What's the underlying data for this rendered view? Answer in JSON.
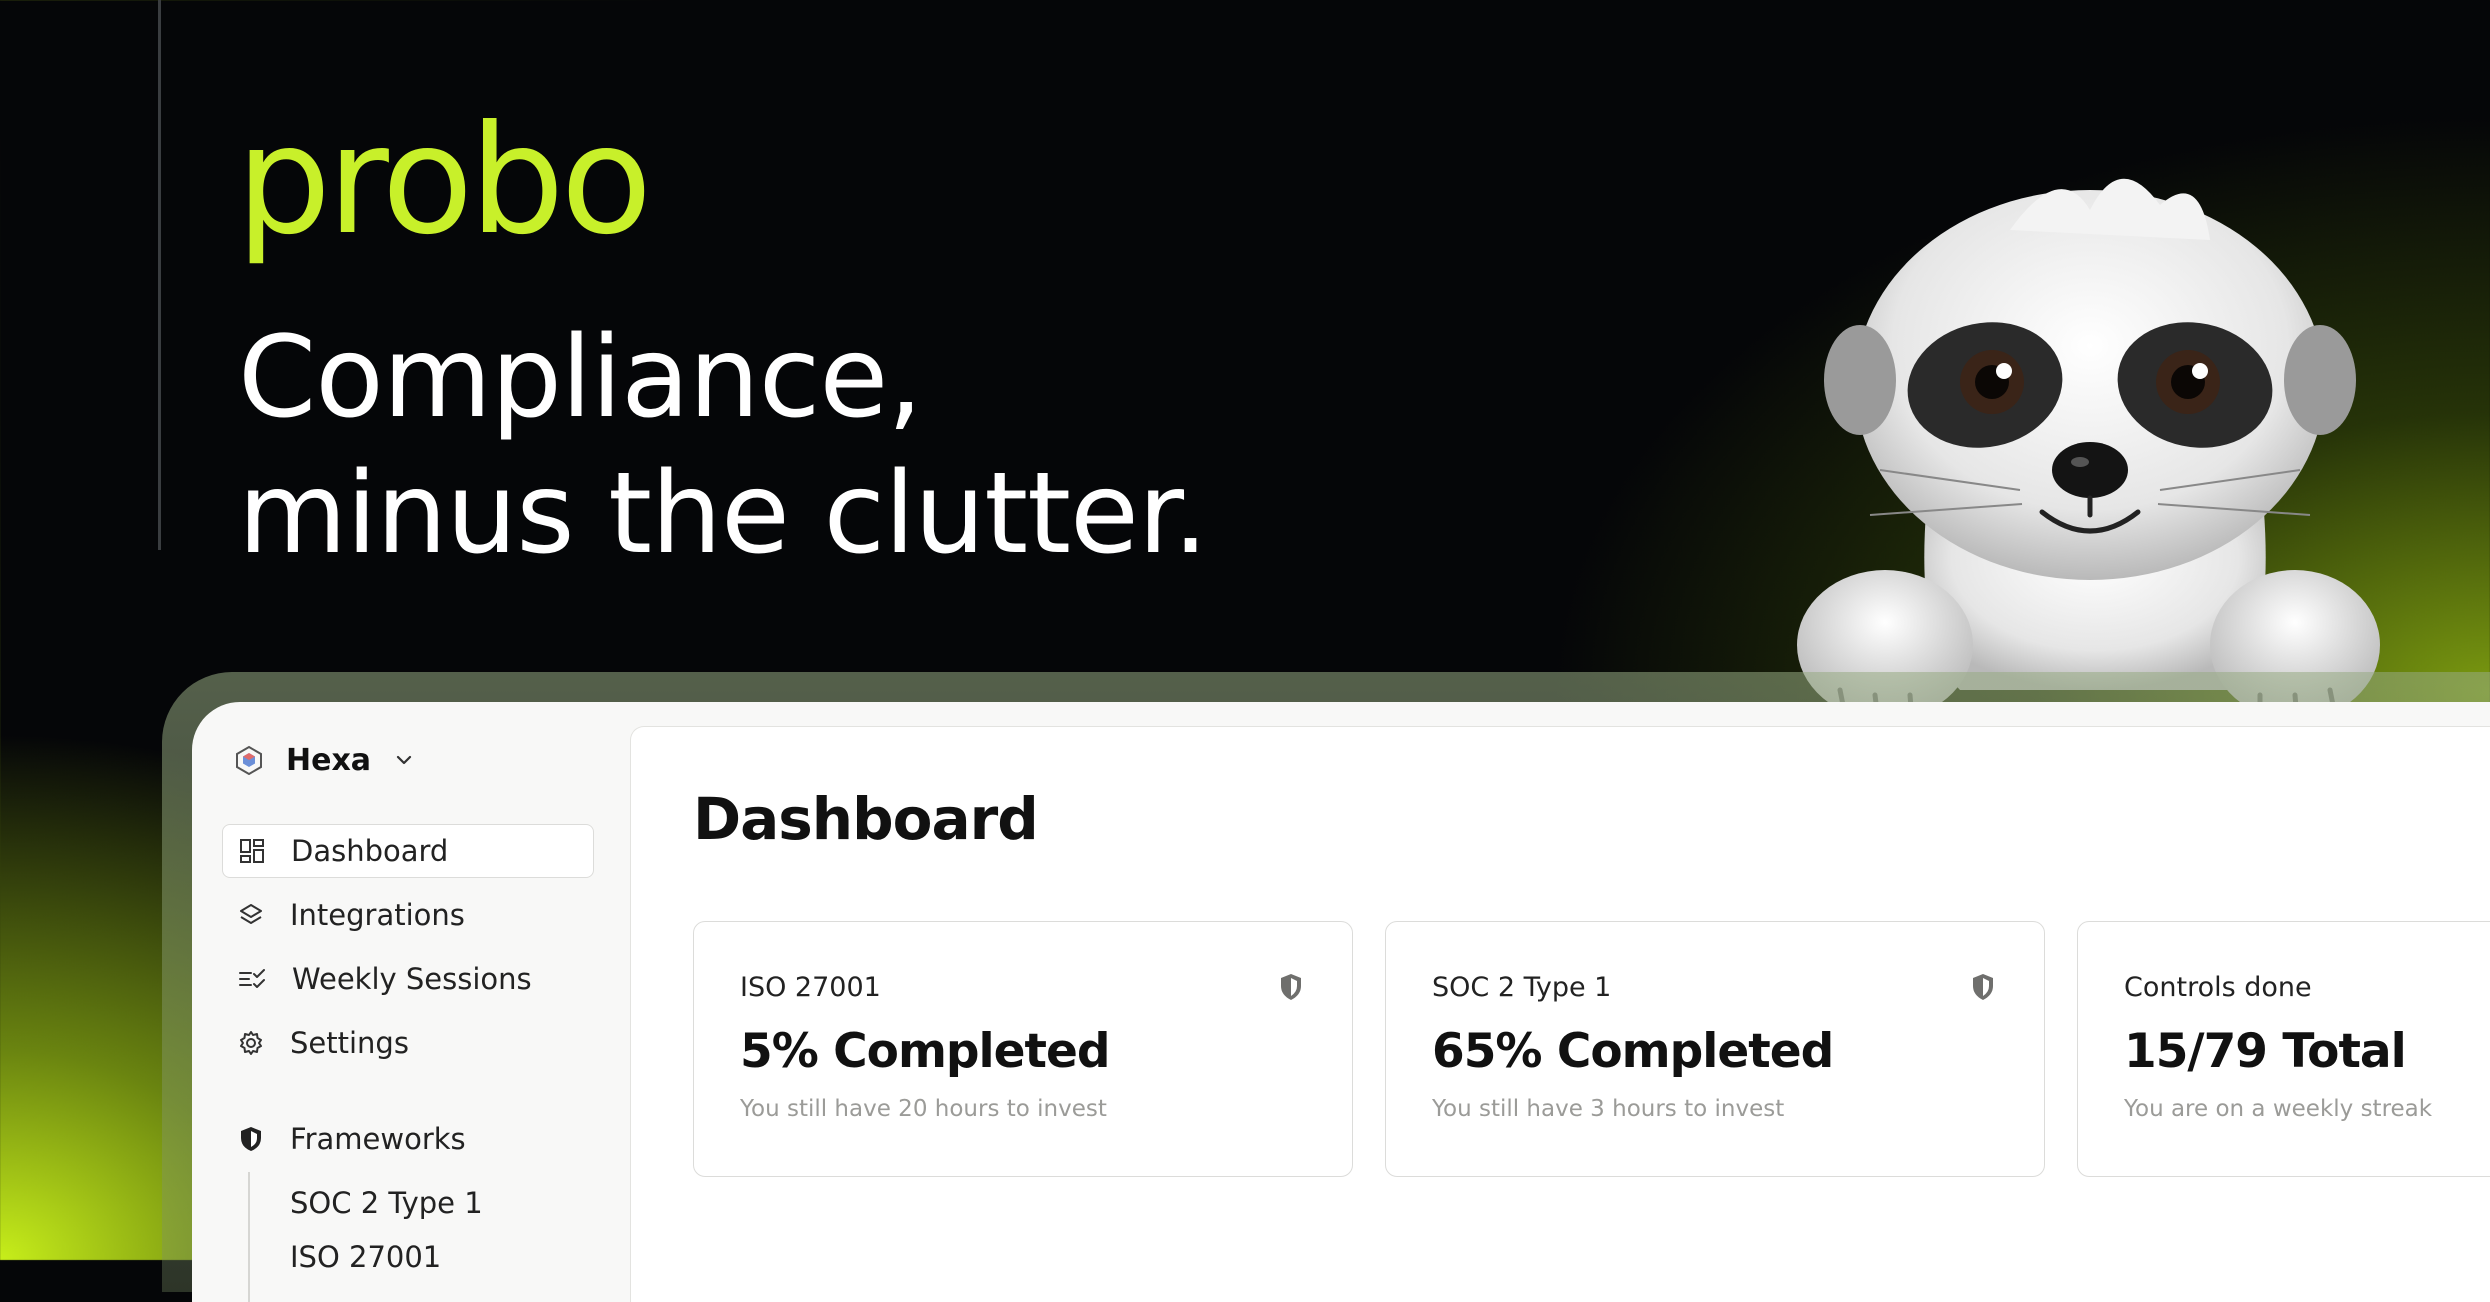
{
  "brand": {
    "logo": "probo",
    "headline_line1": "Compliance,",
    "headline_line2": "minus the clutter.",
    "accent": "#c8f02a"
  },
  "sidebar": {
    "org_name": "Hexa",
    "items": [
      {
        "label": "Dashboard",
        "icon": "dashboard-grid-icon",
        "active": true
      },
      {
        "label": "Integrations",
        "icon": "layers-icon"
      },
      {
        "label": "Weekly Sessions",
        "icon": "checklist-icon"
      },
      {
        "label": "Settings",
        "icon": "gear-icon"
      }
    ],
    "frameworks": {
      "label": "Frameworks",
      "icon": "shield-icon",
      "children": [
        "SOC 2 Type 1",
        "ISO 27001"
      ]
    }
  },
  "main": {
    "title": "Dashboard",
    "cards": [
      {
        "title": "ISO 27001",
        "value": "5% Completed",
        "subtitle": "You still have 20 hours to invest",
        "icon": "shield-icon"
      },
      {
        "title": "SOC 2 Type 1",
        "value": "65% Completed",
        "subtitle": "You still have 3 hours to invest",
        "icon": "shield-icon"
      },
      {
        "title": "Controls done",
        "value": "15/79 Total",
        "subtitle": "You are on a weekly streak"
      }
    ]
  }
}
